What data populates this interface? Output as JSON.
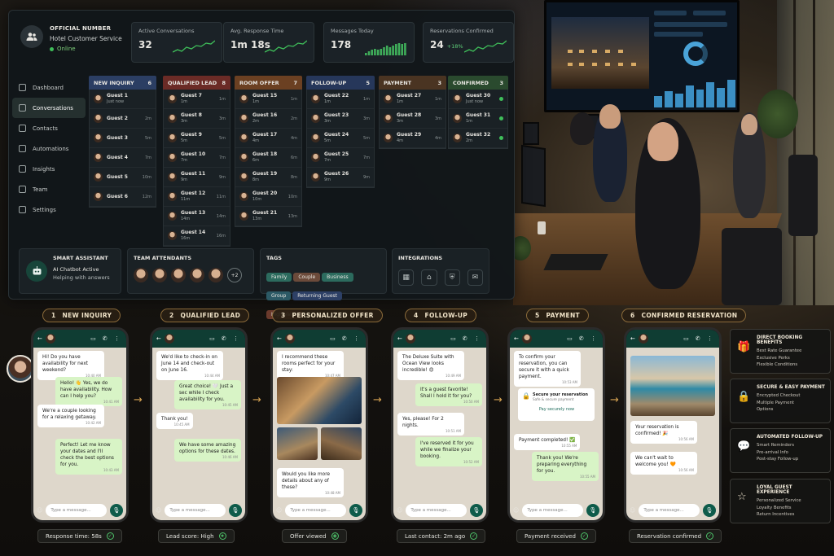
{
  "header": {
    "title": "OFFICIAL NUMBER",
    "subtitle": "Hotel Customer Service",
    "status": "Online"
  },
  "kpis": [
    {
      "label": "Active Conversations",
      "value": "32",
      "delta": ""
    },
    {
      "label": "Avg. Response Time",
      "value": "1m 18s",
      "delta": ""
    },
    {
      "label": "Messages Today",
      "value": "178",
      "delta": ""
    },
    {
      "label": "Reservations Confirmed",
      "value": "24",
      "delta": "+18%"
    }
  ],
  "nav": [
    "Dashboard",
    "Conversations",
    "Contacts",
    "Automations",
    "Insights",
    "Team",
    "Settings"
  ],
  "columns": [
    {
      "title": "NEW INQUIRY",
      "count": "6",
      "color": "#2b3e63",
      "cards": [
        [
          "Guest 1",
          "Just now",
          ""
        ],
        [
          "Guest 2",
          "",
          "2m"
        ],
        [
          "Guest 3",
          "",
          "5m"
        ],
        [
          "Guest 4",
          "",
          "7m"
        ],
        [
          "Guest 5",
          "",
          "10m"
        ],
        [
          "Guest 6",
          "",
          "12m"
        ]
      ]
    },
    {
      "title": "QUALIFIED LEAD",
      "count": "8",
      "color": "#6b2b26",
      "cards": [
        [
          "Guest 7",
          "1m",
          "1m"
        ],
        [
          "Guest 8",
          "3m",
          "3m"
        ],
        [
          "Guest 9",
          "5m",
          "5m"
        ],
        [
          "Guest 10",
          "7m",
          "7m"
        ],
        [
          "Guest 11",
          "9m",
          "9m"
        ],
        [
          "Guest 12",
          "11m",
          "11m"
        ],
        [
          "Guest 13",
          "14m",
          "14m"
        ],
        [
          "Guest 14",
          "16m",
          "16m"
        ]
      ]
    },
    {
      "title": "ROOM OFFER",
      "count": "7",
      "color": "#6b4022",
      "cards": [
        [
          "Guest 15",
          "1m",
          "1m"
        ],
        [
          "Guest 16",
          "2m",
          "2m"
        ],
        [
          "Guest 17",
          "4m",
          "4m"
        ],
        [
          "Guest 18",
          "6m",
          "6m"
        ],
        [
          "Guest 19",
          "8m",
          "8m"
        ],
        [
          "Guest 20",
          "10m",
          "10m"
        ],
        [
          "Guest 21",
          "13m",
          "13m"
        ]
      ]
    },
    {
      "title": "FOLLOW-UP",
      "count": "5",
      "color": "#26375a",
      "cards": [
        [
          "Guest 22",
          "1m",
          "1m"
        ],
        [
          "Guest 23",
          "3m",
          "3m"
        ],
        [
          "Guest 24",
          "5m",
          "5m"
        ],
        [
          "Guest 25",
          "7m",
          "7m"
        ],
        [
          "Guest 26",
          "9m",
          "9m"
        ]
      ]
    },
    {
      "title": "PAYMENT",
      "count": "3",
      "color": "#4a3422",
      "cards": [
        [
          "Guest 27",
          "1m",
          "1m"
        ],
        [
          "Guest 28",
          "3m",
          "3m"
        ],
        [
          "Guest 29",
          "4m",
          "4m"
        ]
      ]
    },
    {
      "title": "CONFIRMED",
      "count": "3",
      "color": "#2a4a2e",
      "cards": [
        [
          "Guest 30",
          "Just now",
          ""
        ],
        [
          "Guest 31",
          "1m",
          ""
        ],
        [
          "Guest 32",
          "2m",
          ""
        ]
      ]
    }
  ],
  "assistant": {
    "title": "SMART ASSISTANT",
    "line1": "AI Chatbot Active",
    "line2": "Helping with answers"
  },
  "team": {
    "title": "TEAM ATTENDANTS",
    "more": "+2"
  },
  "tags": {
    "title": "TAGS",
    "items": [
      {
        "label": "Family",
        "bg": "#2c6b5e"
      },
      {
        "label": "Couple",
        "bg": "#6b4a3a"
      },
      {
        "label": "Business",
        "bg": "#2c6b5e"
      },
      {
        "label": "Group",
        "bg": "#2c5a66"
      },
      {
        "label": "Returning Guest",
        "bg": "#2d4066"
      },
      {
        "label": "High Value",
        "bg": "#6b3a2c"
      }
    ]
  },
  "integrations": {
    "title": "INTEGRATIONS",
    "icons": [
      "calendar-icon",
      "bank-icon",
      "shield-icon",
      "mail-icon"
    ]
  },
  "steps": [
    {
      "num": "1",
      "label": "NEW INQUIRY",
      "status": "Response time: 58s"
    },
    {
      "num": "2",
      "label": "QUALIFIED LEAD",
      "status": "Lead score: High"
    },
    {
      "num": "3",
      "label": "PERSONALIZED OFFER",
      "status": "Offer viewed"
    },
    {
      "num": "4",
      "label": "FOLLOW-UP",
      "status": "Last contact: 2m ago"
    },
    {
      "num": "5",
      "label": "PAYMENT",
      "status": "Payment received"
    },
    {
      "num": "6",
      "label": "CONFIRMED RESERVATION",
      "status": "Reservation confirmed"
    }
  ],
  "input_placeholder": "Type a message...",
  "chats": {
    "p1": [
      [
        "in",
        "Hi! Do you have availability for next weekend?",
        "10:40 AM"
      ],
      [
        "out",
        "Hello! 👋 Yes, we do have availability. How can I help you?",
        "10:41 AM"
      ],
      [
        "in",
        "We're a couple looking for a relaxing getaway.",
        "10:42 AM"
      ],
      [
        "out",
        "Perfect! Let me know your dates and I'll check the best options for you.",
        "10:43 AM"
      ]
    ],
    "p2": [
      [
        "in",
        "We'd like to check-in on June 14 and check-out on June 16.",
        "10:44 AM"
      ],
      [
        "out",
        "Great choice! 🤍 Just a sec while I check availability for you.",
        "10:45 AM"
      ],
      [
        "in",
        "Thank you!",
        "10:45 AM"
      ],
      [
        "out",
        "We have some amazing options for these dates.",
        "10:46 AM"
      ]
    ],
    "p3": [
      [
        "in",
        "I recommend these rooms perfect for your stay:",
        "10:47 AM"
      ],
      [
        "in",
        "Would you like more details about any of these?",
        "10:48 AM"
      ]
    ],
    "p4": [
      [
        "in",
        "The Deluxe Suite with Ocean View looks incredible! 😍",
        "10:49 AM"
      ],
      [
        "out",
        "It's a guest favorite! Shall I hold it for you?",
        "10:50 AM"
      ],
      [
        "in",
        "Yes, please! For 2 nights.",
        "10:51 AM"
      ],
      [
        "out",
        "I've reserved it for you while we finalize your booking.",
        "10:52 AM"
      ]
    ],
    "p5": [
      [
        "in",
        "To confirm your reservation, you can secure it with a quick payment.",
        "10:53 AM"
      ],
      [
        "in",
        "Payment completed! ✅",
        "10:55 AM"
      ],
      [
        "out",
        "Thank you! We're preparing everything for you.",
        "10:55 AM"
      ]
    ],
    "p6": [
      [
        "in",
        "Your reservation is confirmed! 🎉",
        "10:56 AM"
      ],
      [
        "in",
        "We can't wait to welcome you! 🧡",
        "10:56 AM"
      ]
    ]
  },
  "secure_card": {
    "title": "Secure your reservation",
    "sub": "Safe & secure payment",
    "link": "Pay securely now"
  },
  "benefits": [
    {
      "icon": "gift-icon",
      "glyph": "🎁",
      "title": "DIRECT BOOKING BENEFITS",
      "lines": [
        "Best Rate Guarantee",
        "Exclusive Perks",
        "Flexible Conditions"
      ]
    },
    {
      "icon": "lock-icon",
      "glyph": "🔒",
      "title": "SECURE & EASY PAYMENT",
      "lines": [
        "Encrypted Checkout",
        "Multiple Payment",
        "Options"
      ]
    },
    {
      "icon": "chat-icon",
      "glyph": "💬",
      "title": "AUTOMATED FOLLOW-UP",
      "lines": [
        "Smart Reminders",
        "Pre-arrival Info",
        "Post-stay Follow-up"
      ]
    },
    {
      "icon": "star-icon",
      "glyph": "☆",
      "title": "LOYAL GUEST EXPERIENCE",
      "lines": [
        "Personalized Service",
        "Loyalty Benefits",
        "Return Incentives"
      ]
    }
  ],
  "colors": {
    "accent": "#3fbf5a",
    "brand_green": "#0f3d33",
    "step_border": "#8a6a3a"
  }
}
